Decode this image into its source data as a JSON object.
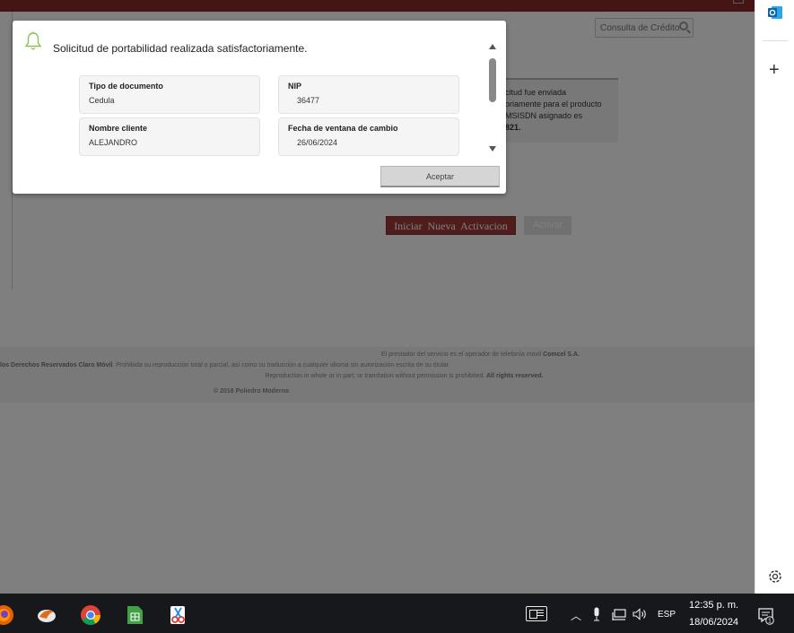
{
  "page": {
    "credit_search": {
      "placeholder": "Consulta de Crédito"
    },
    "info_box": {
      "lines": [
        "citud fue enviada",
        "oriamente para el producto",
        "MSISDN asignado es",
        "821."
      ]
    },
    "buttons": {
      "new_activation": "Iniciar Nueva Activacion",
      "next": "Activar"
    },
    "footer": {
      "line1_a": "El prestador del servicio es el operador de telefonía móvil ",
      "line1_b": "Comcel S.A.",
      "line2_a": "los Derechos Reservados Claro Móvil",
      "line2_b": ". Prohibida su reproducción total o parcial, así como su traducción a cualquier idioma sin autorización escrita de su titular.",
      "line3_a": "Reproduction in whole or in part, or translation without permission is prohibited. ",
      "line3_b": "All rights reserved.",
      "line4": "© 2016 Poliedro Moderno"
    }
  },
  "modal": {
    "title": "Solicitud de portabilidad realizada satisfactoriamente.",
    "fields": [
      {
        "label": "Tipo de documento",
        "value": "Cedula"
      },
      {
        "label": "NIP",
        "value": "36477"
      },
      {
        "label": "Nombre cliente",
        "value": "ALEJANDRO"
      },
      {
        "label": "Fecha de ventana de cambio",
        "value": "26/06/2024"
      }
    ],
    "accept_label": "Aceptar",
    "bell_color": "#8cc152"
  },
  "taskbar": {
    "apps": [
      "firefox-icon",
      "fox-app-icon",
      "chrome-icon",
      "spreadsheet-icon",
      "snipping-tool-icon"
    ],
    "language": "ESP",
    "time": "12:35 p. m.",
    "date": "18/06/2024",
    "notification_count": "1"
  },
  "colors": {
    "brand_red": "#a03a3a",
    "overlay": "rgba(0,0,0,0.5)"
  }
}
